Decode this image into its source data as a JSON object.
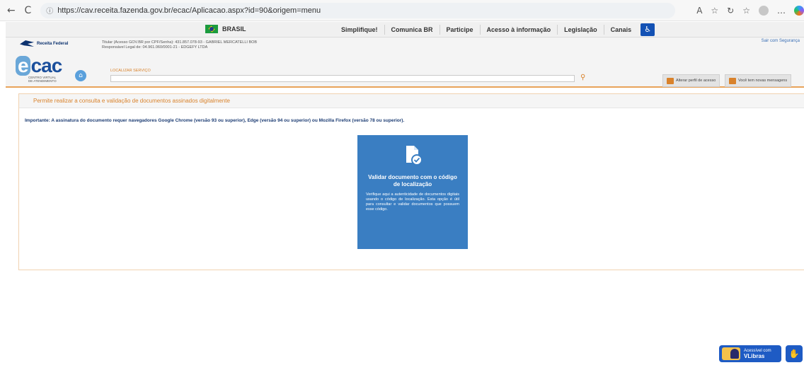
{
  "browser": {
    "back_glyph": "←",
    "reload_glyph": "C",
    "lock_glyph": "ⓘ",
    "url": "https://cav.receita.fazenda.gov.br/ecac/Aplicacao.aspx?id=90&origem=menu",
    "right_icons": [
      "A",
      "☆",
      "↻",
      "☆",
      "…"
    ]
  },
  "gov_bar": {
    "brasil": "BRASIL",
    "links": [
      "Simplifique!",
      "Comunica BR",
      "Participe",
      "Acesso à informação",
      "Legislação",
      "Canais"
    ]
  },
  "header": {
    "rf_logo": "Receita Federal",
    "titular_line1": "Titular (Acesso GOV.BR por CPF/Senha): 431.857.078-93 - GABRIEL MERCATELLI BOB",
    "titular_line2": "Responsável Legal de: 04.961.060/0001-21 - EDGEFY LTDA",
    "ecac_word": "cac",
    "ecac_e": "e",
    "ecac_sub1": "CENTRO VIRTUAL",
    "ecac_sub2": "DE ATENDIMENTO",
    "search_label": "LOCALIZAR SERVIÇO",
    "search_value": "",
    "sair": "Sair com Segurança",
    "alterar_perfil": "Alterar perfil de acesso",
    "mensagens": "Você tem novas mensagens"
  },
  "content": {
    "title": "Permite realizar a consulta e validação de documentos assinados digitalmente",
    "notice": "Importante: A assinatura do documento requer navegadores Google Chrome (versão 93 ou superior), Edge (versão 94 ou superior) ou Mozilla Firefox (versão 78 ou superior).",
    "card": {
      "title": "Validar documento com o código de localização",
      "text": "Verifique aqui a autenticidade de documentos digitais usando o código de localização. Esta opção é útil para consultar e validar documentos que possuem esse código."
    }
  },
  "vlibras": {
    "line1": "Acessível com",
    "line2": "VLibras"
  }
}
